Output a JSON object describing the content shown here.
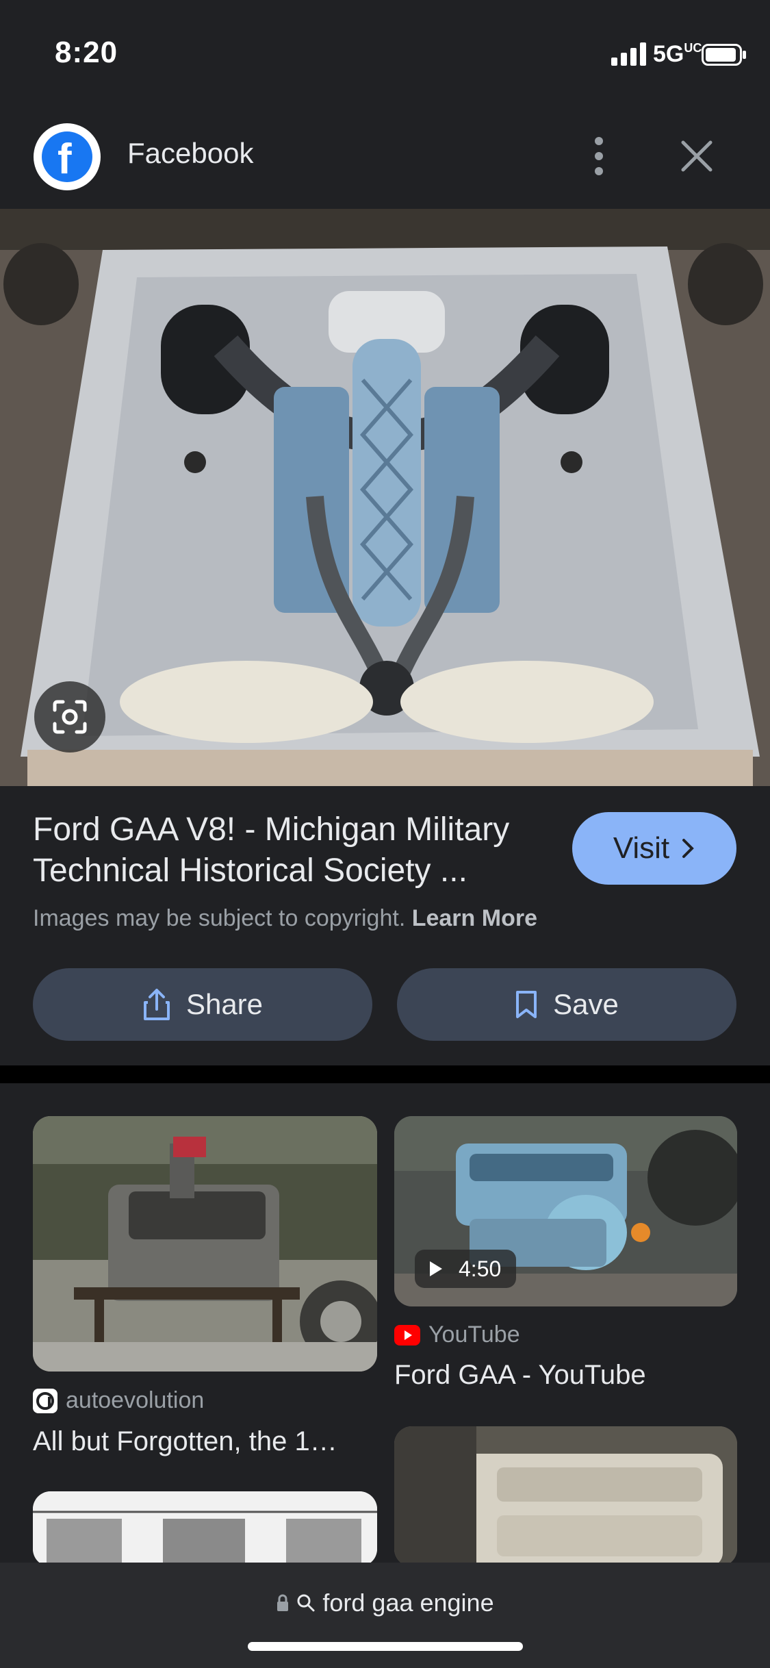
{
  "status_bar": {
    "time": "8:20",
    "network": "5G",
    "network_suffix": "UC"
  },
  "header": {
    "source_name": "Facebook"
  },
  "result": {
    "title": "Ford GAA V8! - Michigan Military Technical Historical Society ...",
    "visit_label": "Visit",
    "copyright_text": "Images may be subject to copyright.",
    "learn_more_label": "Learn More"
  },
  "actions": {
    "share_label": "Share",
    "save_label": "Save"
  },
  "related": [
    {
      "source": "autoevolution",
      "title": "All but Forgotten, the 1…"
    },
    {
      "source": "YouTube",
      "title": "Ford GAA - YouTube",
      "duration": "4:50"
    }
  ],
  "url_bar": {
    "query": "ford gaa engine"
  },
  "colors": {
    "background": "#202124",
    "accent": "#8ab4f8",
    "button_bg": "#3c4555",
    "facebook_blue": "#1877f2",
    "youtube_red": "#ff0000"
  }
}
